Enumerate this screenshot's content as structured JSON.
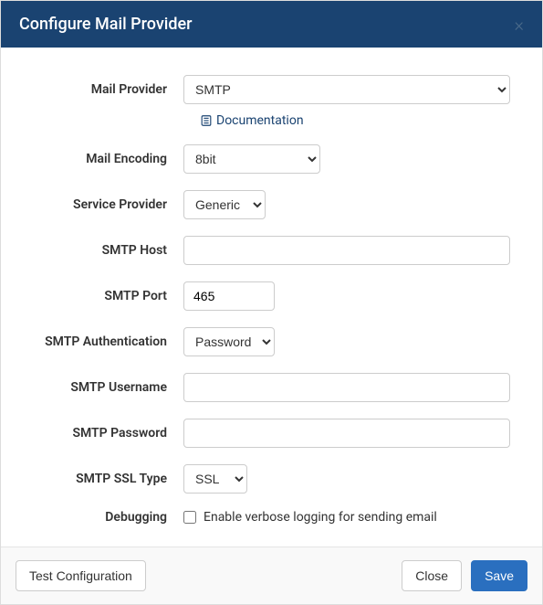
{
  "header": {
    "title": "Configure Mail Provider"
  },
  "form": {
    "mail_provider": {
      "label": "Mail Provider",
      "value": "SMTP"
    },
    "documentation": {
      "label": "Documentation"
    },
    "mail_encoding": {
      "label": "Mail Encoding",
      "value": "8bit"
    },
    "service_provider": {
      "label": "Service Provider",
      "value": "Generic"
    },
    "smtp_host": {
      "label": "SMTP Host",
      "value": ""
    },
    "smtp_port": {
      "label": "SMTP Port",
      "value": "465"
    },
    "smtp_auth": {
      "label": "SMTP Authentication",
      "value": "Password"
    },
    "smtp_username": {
      "label": "SMTP Username",
      "value": ""
    },
    "smtp_password": {
      "label": "SMTP Password",
      "value": ""
    },
    "smtp_ssl": {
      "label": "SMTP SSL Type",
      "value": "SSL"
    },
    "debugging": {
      "label": "Debugging",
      "checkbox_label": "Enable verbose logging for sending email",
      "checked": false
    }
  },
  "footer": {
    "test_label": "Test Configuration",
    "close_label": "Close",
    "save_label": "Save"
  }
}
